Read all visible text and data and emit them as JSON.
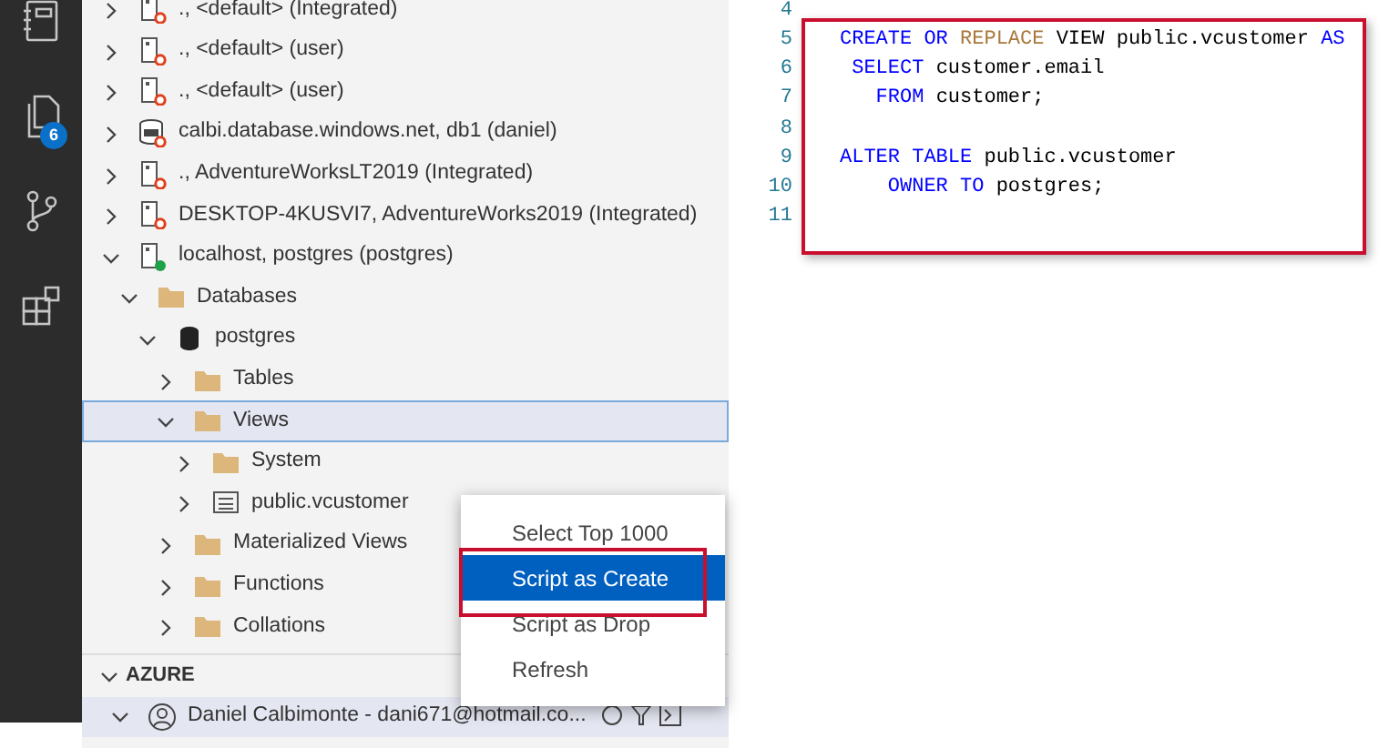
{
  "activity_bar": {
    "items": [
      {
        "kind": "notebook"
      },
      {
        "kind": "files",
        "badge": "6"
      },
      {
        "kind": "branch"
      },
      {
        "kind": "extensions"
      }
    ]
  },
  "tree": [
    {
      "kind": "server",
      "label": "., <default> (Integrated)",
      "expanded": false,
      "connected": false,
      "selected": false
    },
    {
      "kind": "server",
      "label": "., <default> (user)",
      "expanded": false,
      "connected": false,
      "selected": false
    },
    {
      "kind": "server",
      "label": "., <default> (user)",
      "expanded": false,
      "connected": false,
      "selected": false
    },
    {
      "kind": "sqldb",
      "label": "calbi.database.windows.net, db1 (daniel)",
      "expanded": false,
      "connected": false,
      "selected": false
    },
    {
      "kind": "server",
      "label": "., AdventureWorksLT2019 (Integrated)",
      "expanded": false,
      "connected": false,
      "selected": false
    },
    {
      "kind": "server",
      "label": "DESKTOP-4KUSVI7, AdventureWorks2019 (Integrated)",
      "expanded": false,
      "connected": false,
      "selected": false
    },
    {
      "kind": "server",
      "label": "localhost, postgres (postgres)",
      "expanded": true,
      "connected": true,
      "selected": false,
      "children": [
        {
          "kind": "folder",
          "label": "Databases",
          "expanded": true,
          "selected": false,
          "children": [
            {
              "kind": "database",
              "label": "postgres",
              "expanded": true,
              "selected": false,
              "children": [
                {
                  "kind": "folder",
                  "label": "Tables",
                  "expanded": false,
                  "selected": false
                },
                {
                  "kind": "folder",
                  "label": "Views",
                  "expanded": true,
                  "selected": true,
                  "children": [
                    {
                      "kind": "folder",
                      "label": "System",
                      "expanded": false,
                      "selected": false
                    },
                    {
                      "kind": "view",
                      "label": "public.vcustomer",
                      "expanded": false,
                      "selected": false
                    }
                  ]
                },
                {
                  "kind": "folder",
                  "label": "Materialized Views",
                  "expanded": false,
                  "selected": false
                },
                {
                  "kind": "folder",
                  "label": "Functions",
                  "expanded": false,
                  "selected": false
                },
                {
                  "kind": "folder",
                  "label": "Collations",
                  "expanded": false,
                  "selected": false
                }
              ]
            }
          ]
        }
      ]
    }
  ],
  "azure": {
    "title": "AZURE",
    "expanded": true,
    "account": {
      "label": "Daniel Calbimonte - dani671@hotmail.co...",
      "expanded": true
    }
  },
  "context_menu": [
    {
      "label": "Select Top 1000",
      "selected": false
    },
    {
      "label": "Script as Create",
      "selected": true
    },
    {
      "label": "Script as Drop",
      "selected": false
    },
    {
      "label": "Refresh",
      "selected": false
    }
  ],
  "editor": {
    "lines": [
      {
        "number": "4"
      },
      {
        "number": "5",
        "tokens": [
          {
            "kind": "keyword",
            "text": "CREATE OR"
          },
          {
            "kind": "function",
            "text": " REPLACE"
          },
          {
            "kind": "plain",
            "text": " VIEW public.vcustomer"
          },
          {
            "kind": "keyword",
            "text": " AS"
          }
        ]
      },
      {
        "number": "6",
        "tokens": [
          {
            "kind": "keyword",
            "text": " SELECT"
          },
          {
            "kind": "plain",
            "text": " customer.email"
          }
        ]
      },
      {
        "number": "7",
        "tokens": [
          {
            "kind": "keyword",
            "text": "   FROM"
          },
          {
            "kind": "plain",
            "text": " customer;"
          }
        ]
      },
      {
        "number": "8"
      },
      {
        "number": "9",
        "tokens": [
          {
            "kind": "keyword",
            "text": "ALTER TABLE"
          },
          {
            "kind": "plain",
            "text": " public.vcustomer"
          }
        ]
      },
      {
        "number": "10",
        "tokens": [
          {
            "kind": "keyword",
            "text": "    OWNER TO"
          },
          {
            "kind": "plain",
            "text": " postgres;"
          }
        ]
      },
      {
        "number": "11"
      }
    ]
  }
}
